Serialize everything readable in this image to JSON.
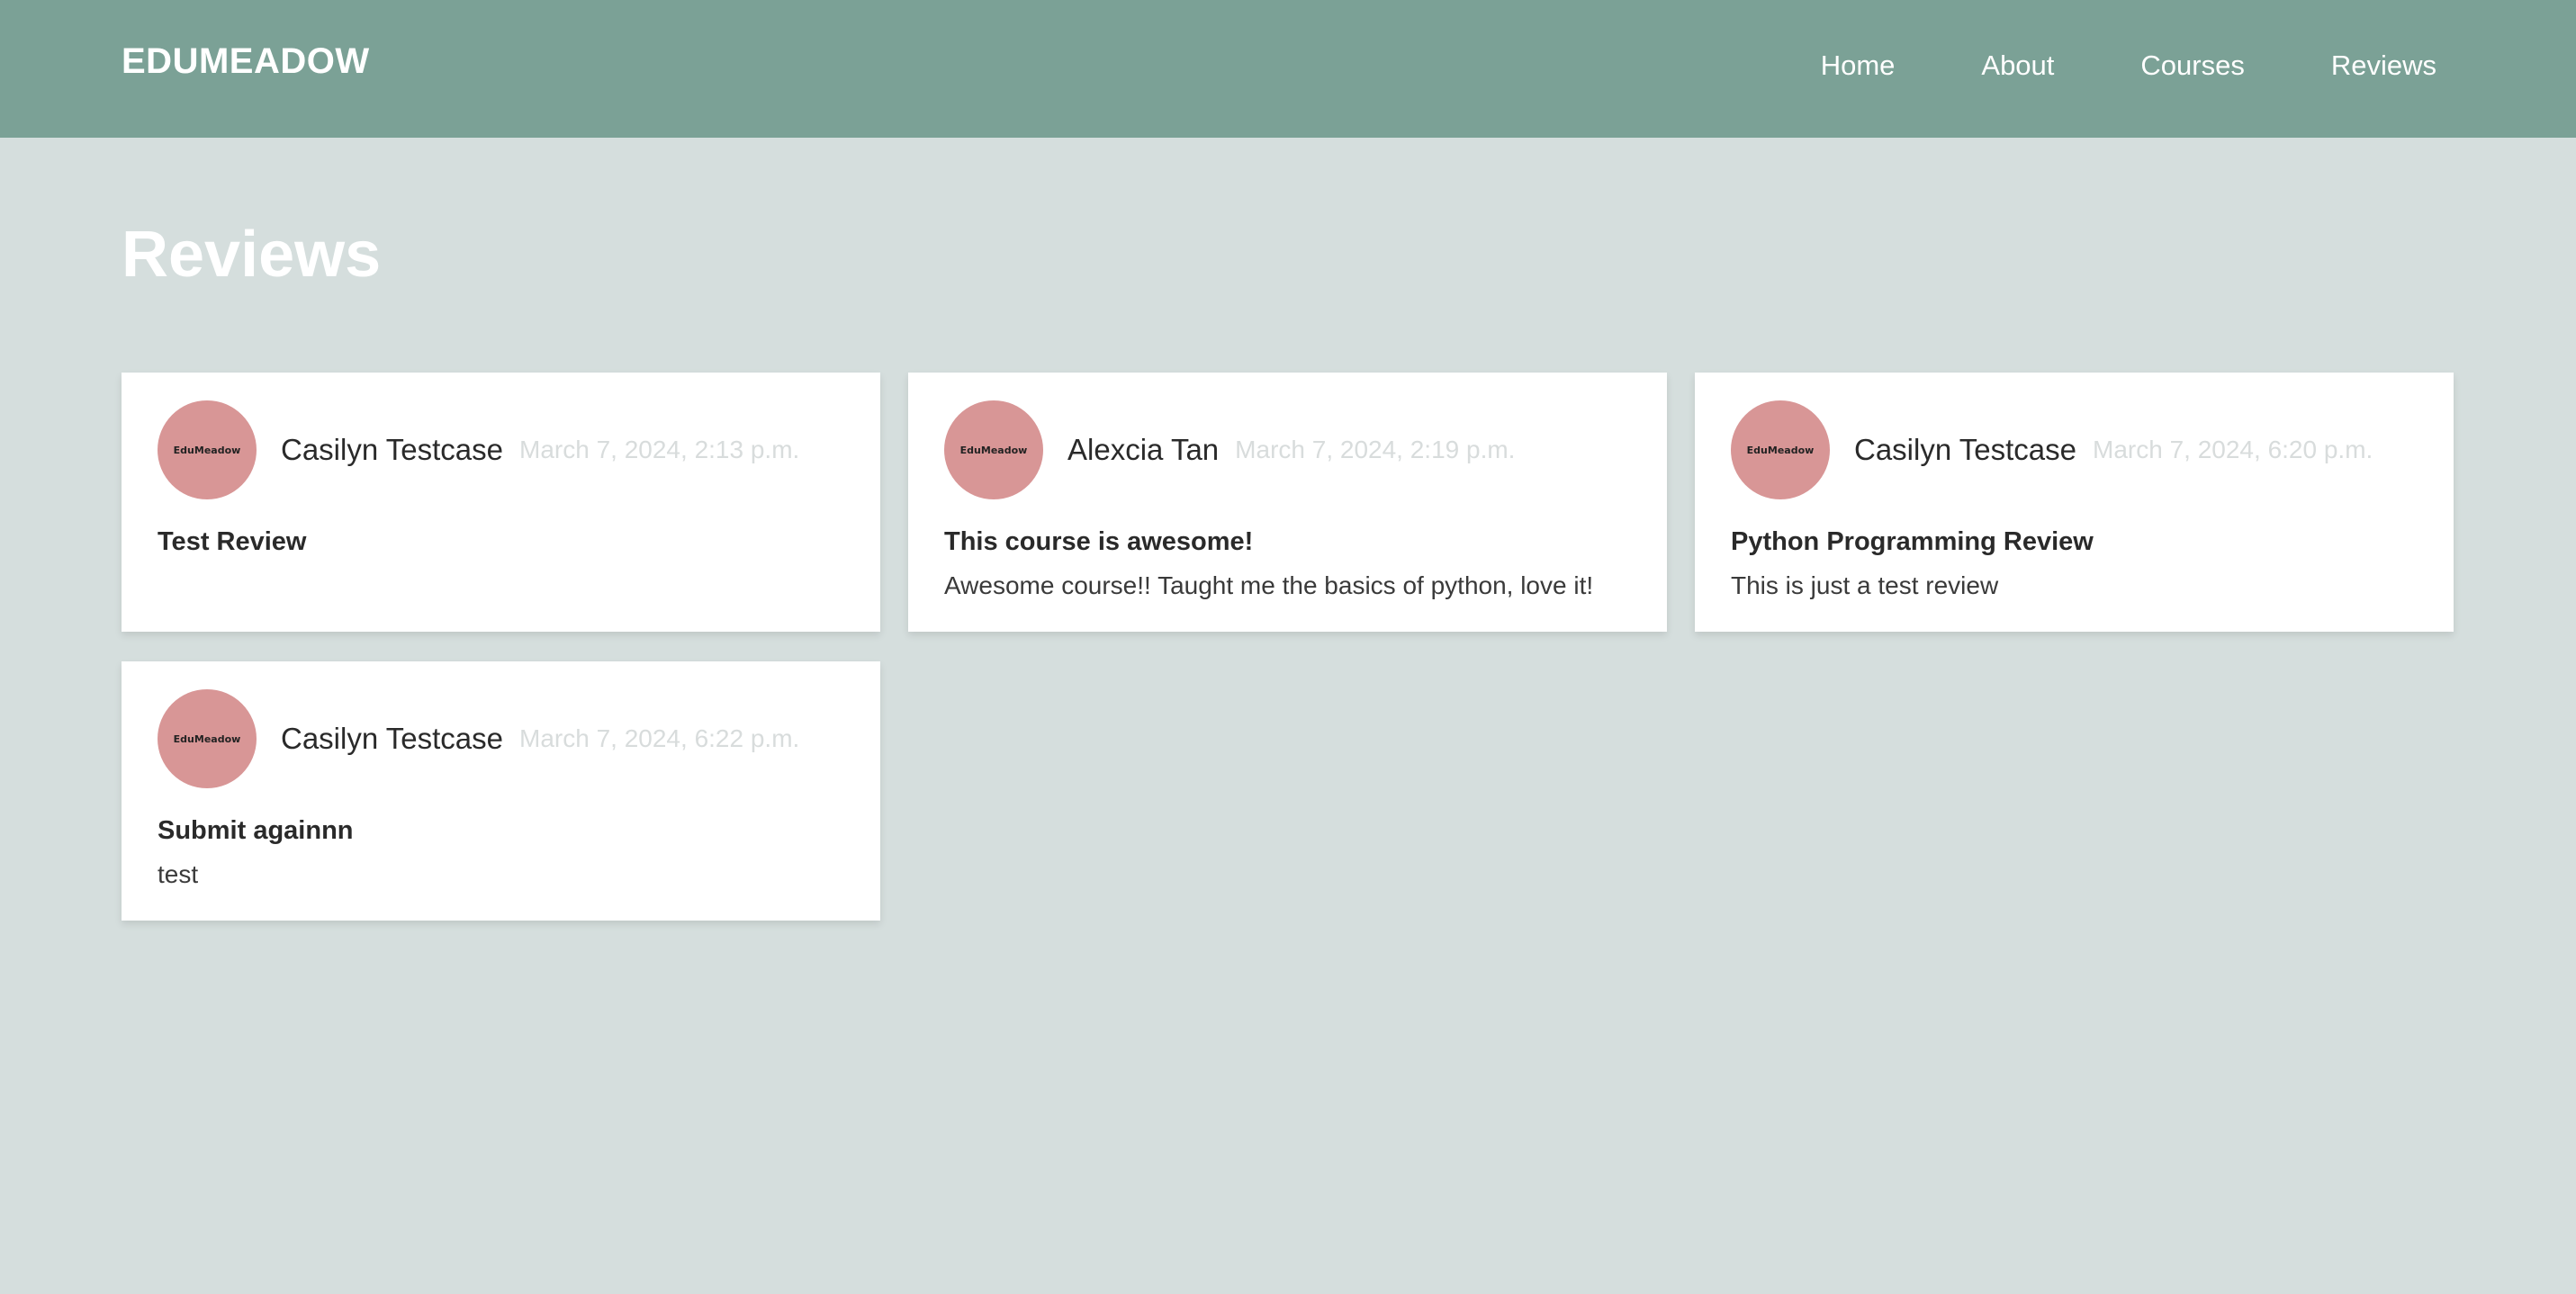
{
  "nav": {
    "brand": "EDUMEADOW",
    "links": [
      {
        "label": "Home"
      },
      {
        "label": "About"
      },
      {
        "label": "Courses"
      },
      {
        "label": "Reviews"
      }
    ]
  },
  "page": {
    "title": "Reviews"
  },
  "reviews": [
    {
      "avatar_text": "EduMeadow",
      "author": "Casilyn Testcase",
      "date": "March 7, 2024, 2:13 p.m.",
      "title": "Test Review",
      "body": ""
    },
    {
      "avatar_text": "EduMeadow",
      "author": "Alexcia Tan",
      "date": "March 7, 2024, 2:19 p.m.",
      "title": "This course is awesome!",
      "body": "Awesome course!! Taught me the basics of python, love it!"
    },
    {
      "avatar_text": "EduMeadow",
      "author": "Casilyn Testcase",
      "date": "March 7, 2024, 6:20 p.m.",
      "title": "Python Programming Review",
      "body": "This is just a test review"
    },
    {
      "avatar_text": "EduMeadow",
      "author": "Casilyn Testcase",
      "date": "March 7, 2024, 6:22 p.m.",
      "title": "Submit againnn",
      "body": "test"
    }
  ],
  "colors": {
    "navbar": "#7ba196",
    "background": "#d5dedd",
    "avatar": "#d89696",
    "date_text": "#d8dcdc"
  }
}
